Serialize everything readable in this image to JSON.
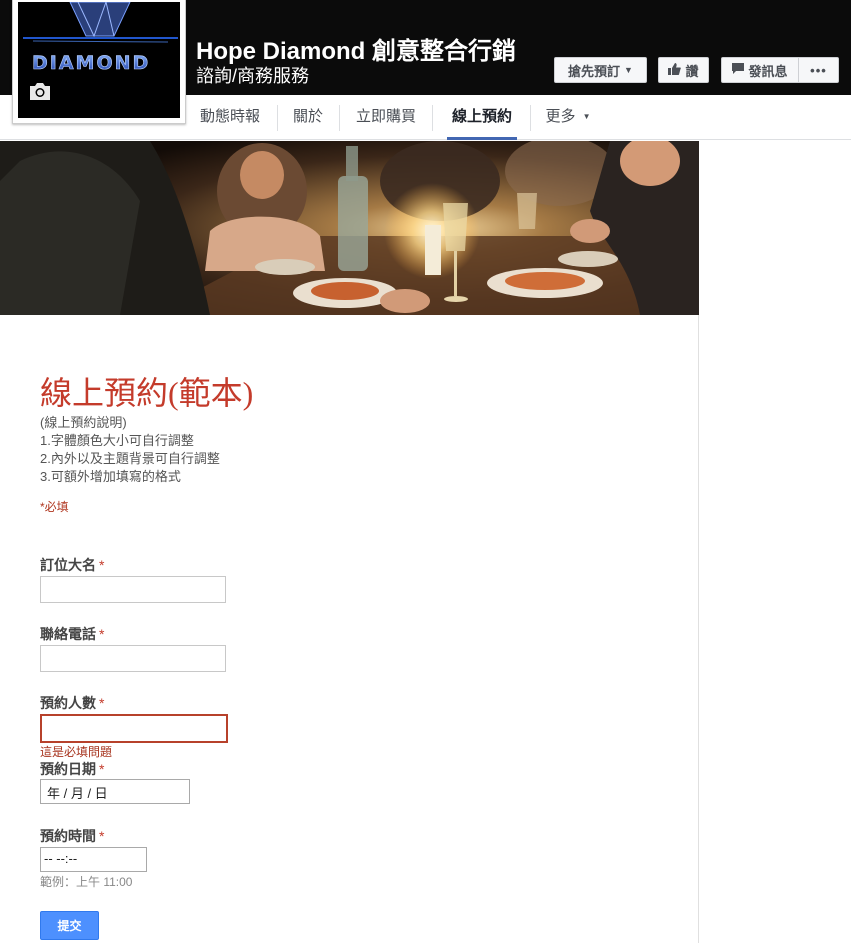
{
  "header": {
    "page_name": "Hope Diamond 創意整合行銷",
    "category": "諮詢/商務服務",
    "buttons": {
      "book": "搶先預訂",
      "like": "讚",
      "message": "發訊息",
      "more": "•••"
    }
  },
  "tabs": [
    {
      "label": "動態時報",
      "active": false
    },
    {
      "label": "關於",
      "active": false
    },
    {
      "label": "立即購買",
      "active": false
    },
    {
      "label": "線上預約",
      "active": true
    },
    {
      "label": "更多",
      "active": false
    }
  ],
  "form": {
    "title": "線上預約(範本)",
    "description": [
      "(線上預約說明)",
      "1.字體顏色大小可自行調整",
      "2.內外以及主題背景可自行調整",
      "3.可額外增加填寫的格式"
    ],
    "required_note": "*必填",
    "questions": [
      {
        "label": "訂位大名",
        "star": "*"
      },
      {
        "label": "聯絡電話",
        "star": "*"
      },
      {
        "label": "預約人數",
        "star": "*",
        "error": "這是必填問題"
      },
      {
        "label": "預約日期",
        "star": "*",
        "placeholder": "年 / 月 / 日"
      },
      {
        "label": "預約時間",
        "star": "*",
        "placeholder": "-- --:--",
        "hint": "範例：上午 11:00"
      }
    ],
    "submit_label": "提交"
  },
  "colors": {
    "accent": "#c43b2b",
    "tab_active": "#4267b2",
    "submit": "#4d90fe"
  }
}
